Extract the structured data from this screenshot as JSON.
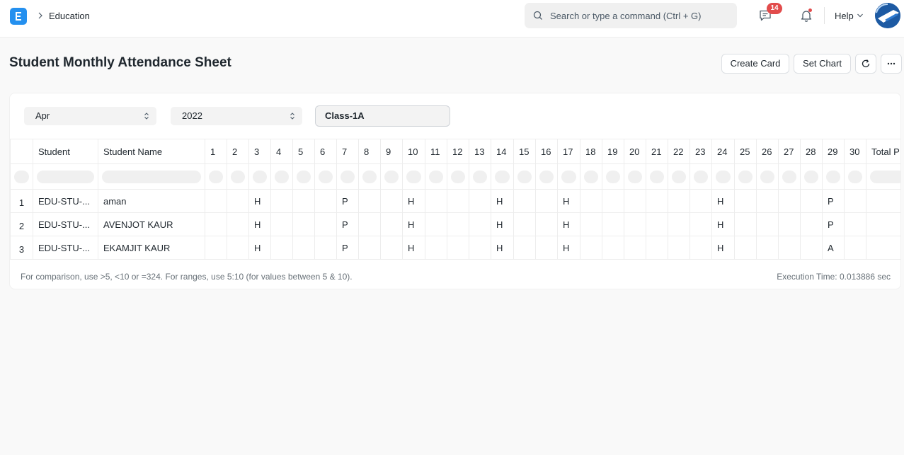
{
  "navbar": {
    "breadcrumb": "Education",
    "search_placeholder": "Search or type a command (Ctrl + G)",
    "notification_count": "14",
    "help_label": "Help",
    "icons": [
      "app-logo-icon",
      "chevron-right-icon",
      "search-icon",
      "chat-icon",
      "bell-icon",
      "chevron-down-icon"
    ]
  },
  "page": {
    "title": "Student Monthly Attendance Sheet",
    "buttons": {
      "create_card": "Create Card",
      "set_chart": "Set Chart"
    }
  },
  "filters": {
    "month": "Apr",
    "year": "2022",
    "student_group": "Class-1A"
  },
  "table": {
    "columns": [
      "Student",
      "Student Name",
      "1",
      "2",
      "3",
      "4",
      "5",
      "6",
      "7",
      "8",
      "9",
      "10",
      "11",
      "12",
      "13",
      "14",
      "15",
      "16",
      "17",
      "18",
      "19",
      "20",
      "21",
      "22",
      "23",
      "24",
      "25",
      "26",
      "27",
      "28",
      "29",
      "30",
      "Total P"
    ],
    "rows": [
      {
        "num": "1",
        "student": "EDU-STU-...",
        "name": "aman",
        "days": [
          "",
          "",
          "H",
          "",
          "",
          "",
          "P",
          "",
          "",
          "H",
          "",
          "",
          "",
          "H",
          "",
          "",
          "H",
          "",
          "",
          "",
          "",
          "",
          "",
          "H",
          "",
          "",
          "",
          "",
          "P",
          "",
          ""
        ]
      },
      {
        "num": "2",
        "student": "EDU-STU-...",
        "name": "AVENJOT KAUR",
        "days": [
          "",
          "",
          "H",
          "",
          "",
          "",
          "P",
          "",
          "",
          "H",
          "",
          "",
          "",
          "H",
          "",
          "",
          "H",
          "",
          "",
          "",
          "",
          "",
          "",
          "H",
          "",
          "",
          "",
          "",
          "P",
          "",
          ""
        ]
      },
      {
        "num": "3",
        "student": "EDU-STU-...",
        "name": "EKAMJIT KAUR",
        "days": [
          "",
          "",
          "H",
          "",
          "",
          "",
          "P",
          "",
          "",
          "H",
          "",
          "",
          "",
          "H",
          "",
          "",
          "H",
          "",
          "",
          "",
          "",
          "",
          "",
          "H",
          "",
          "",
          "",
          "",
          "A",
          "",
          ""
        ]
      }
    ]
  },
  "footer": {
    "hint": "For comparison, use >5, <10 or =324. For ranges, use 5:10 (for values between 5 & 10).",
    "execution_time": "Execution Time: 0.013886 sec"
  },
  "colors": {
    "accent": "#2490ef",
    "badge": "#e24c4c"
  }
}
